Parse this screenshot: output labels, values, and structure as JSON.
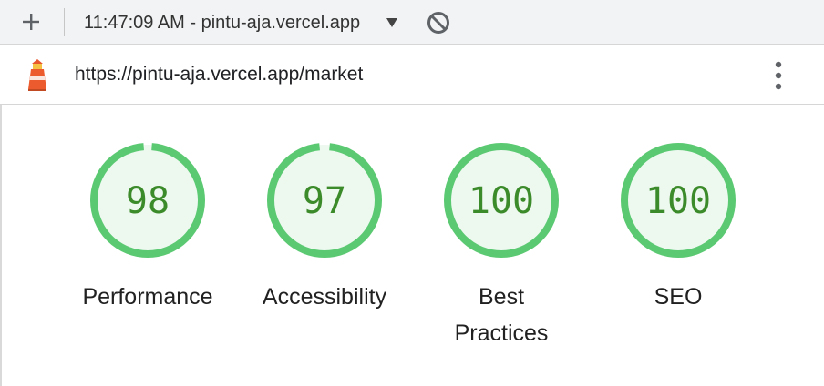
{
  "toolbar": {
    "new_report_icon": "plus-icon",
    "report_title": "11:47:09 AM - pintu-aja.vercel.app",
    "dropdown_icon": "caret-down-icon",
    "clear_icon": "block-icon"
  },
  "urlbar": {
    "logo_icon": "lighthouse-icon",
    "url": "https://pintu-aja.vercel.app/market",
    "menu_icon": "kebab-menu-icon"
  },
  "colors": {
    "pass": "#0cce6b",
    "pass_ring": "#5bc972",
    "pass_text": "#3c8b2a",
    "pass_fill": "#edf8ef"
  },
  "categories": [
    {
      "name": "Performance",
      "score": 98
    },
    {
      "name": "Accessibility",
      "score": 97
    },
    {
      "name": "Best Practices",
      "score": 100
    },
    {
      "name": "SEO",
      "score": 100
    }
  ],
  "gauge_scores_text": [
    "98",
    "97",
    "100",
    "100"
  ],
  "gauge_labels": {
    "performance": "Performance",
    "accessibility": "Accessibility",
    "best_practices_line1": "Best",
    "best_practices_line2": "Practices",
    "seo": "SEO"
  }
}
